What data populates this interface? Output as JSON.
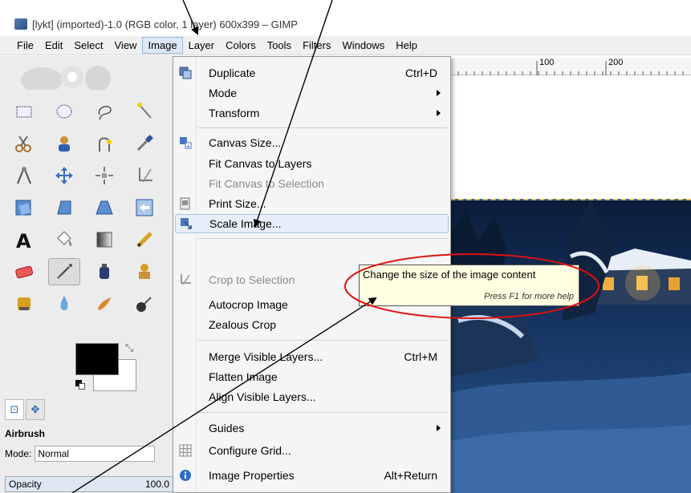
{
  "window": {
    "title": "[lykt] (imported)-1.0 (RGB color, 1 layer) 600x399 – GIMP"
  },
  "menubar": {
    "items": [
      "File",
      "Edit",
      "Select",
      "View",
      "Image",
      "Layer",
      "Colors",
      "Tools",
      "Filters",
      "Windows",
      "Help"
    ],
    "active": "Image"
  },
  "ruler": {
    "labels": [
      "100",
      "200"
    ]
  },
  "image_menu": {
    "items": [
      {
        "label": "Duplicate",
        "shortcut": "Ctrl+D",
        "icon": "duplicate-icon"
      },
      {
        "label": "Mode",
        "submenu": true
      },
      {
        "label": "Transform",
        "submenu": true
      },
      {
        "label": "Canvas Size...",
        "icon": "canvas-size-icon"
      },
      {
        "label": "Fit Canvas to Layers"
      },
      {
        "label": "Fit Canvas to Selection",
        "disabled": true
      },
      {
        "label": "Print Size...",
        "icon": "print-size-icon"
      },
      {
        "label": "Scale Image...",
        "icon": "scale-image-icon",
        "highlighted": true
      },
      {
        "label": "Crop to Selection",
        "icon": "crop-icon",
        "disabled": true
      },
      {
        "label": "Autocrop Image"
      },
      {
        "label": "Zealous Crop"
      },
      {
        "label": "Merge Visible Layers...",
        "shortcut": "Ctrl+M"
      },
      {
        "label": "Flatten Image"
      },
      {
        "label": "Align Visible Layers..."
      },
      {
        "label": "Guides",
        "submenu": true
      },
      {
        "label": "Configure Grid...",
        "icon": "grid-icon"
      },
      {
        "label": "Image Properties",
        "shortcut": "Alt+Return",
        "icon": "info-icon"
      }
    ]
  },
  "tooltip": {
    "text": "Change the size of the image content",
    "help": "Press F1 for more help"
  },
  "tool_options": {
    "tool_name": "Airbrush",
    "mode_label": "Mode:",
    "mode_value": "Normal",
    "opacity_label": "Opacity",
    "opacity_value": "100.0"
  },
  "colors": {
    "foreground": "#000000",
    "background": "#ffffff",
    "menu_highlight": "#e6eef9",
    "tooltip_bg": "#ffffe1",
    "annotation_ellipse": "#e01010"
  }
}
